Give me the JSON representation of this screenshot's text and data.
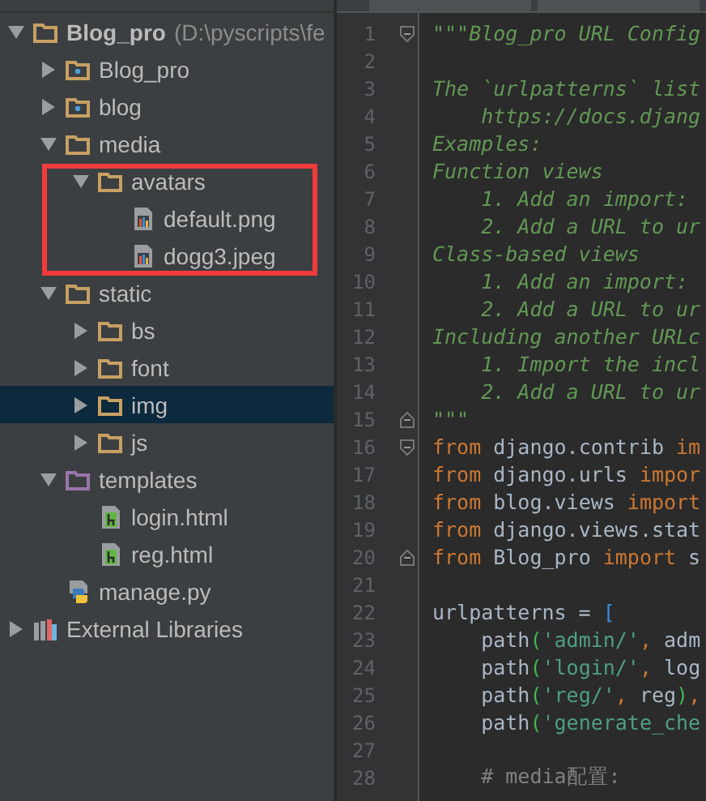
{
  "project_tree": {
    "nodes": [
      {
        "name": "Blog_pro",
        "path": "(D:\\pyscripts\\fe",
        "kind": "folder",
        "expanded": true,
        "selected": false,
        "highlighted": false,
        "children": [
          {
            "name": "Blog_pro",
            "kind": "package",
            "expanded": false,
            "selected": false,
            "highlighted": false
          },
          {
            "name": "blog",
            "kind": "package",
            "expanded": false,
            "selected": false,
            "highlighted": false
          },
          {
            "name": "media",
            "kind": "folder",
            "expanded": true,
            "selected": false,
            "highlighted": false,
            "children": [
              {
                "name": "avatars",
                "kind": "folder",
                "expanded": true,
                "selected": false,
                "highlighted": true,
                "children": [
                  {
                    "name": "default.png",
                    "kind": "image",
                    "selected": false,
                    "highlighted": false
                  },
                  {
                    "name": "dogg3.jpeg",
                    "kind": "image",
                    "selected": false,
                    "highlighted": false
                  }
                ]
              }
            ]
          },
          {
            "name": "static",
            "kind": "folder",
            "expanded": true,
            "selected": false,
            "highlighted": false,
            "children": [
              {
                "name": "bs",
                "kind": "folder",
                "expanded": false,
                "selected": false,
                "highlighted": false
              },
              {
                "name": "font",
                "kind": "folder",
                "expanded": false,
                "selected": false,
                "highlighted": false
              },
              {
                "name": "img",
                "kind": "folder",
                "expanded": false,
                "selected": true,
                "highlighted": false
              },
              {
                "name": "js",
                "kind": "folder",
                "expanded": false,
                "selected": false,
                "highlighted": false
              }
            ]
          },
          {
            "name": "templates",
            "kind": "templates",
            "expanded": true,
            "selected": false,
            "highlighted": false,
            "children": [
              {
                "name": "login.html",
                "kind": "html",
                "selected": false,
                "highlighted": false
              },
              {
                "name": "reg.html",
                "kind": "html",
                "selected": false,
                "highlighted": false
              }
            ]
          },
          {
            "name": "manage.py",
            "kind": "python",
            "selected": false,
            "highlighted": false
          }
        ]
      },
      {
        "name": "External Libraries",
        "kind": "library",
        "expanded": false,
        "selected": false,
        "highlighted": false
      }
    ]
  },
  "editor": {
    "lines": [
      {
        "number": "1",
        "kind": "fold_start",
        "tokens": [
          {
            "kind": "doc",
            "text": "\"\"\"Blog_pro URL Config"
          }
        ]
      },
      {
        "number": "2"
      },
      {
        "number": "3",
        "tokens": [
          {
            "kind": "doc",
            "text": "The `urlpatterns` list"
          }
        ]
      },
      {
        "number": "4",
        "tokens": [
          {
            "kind": "doc",
            "text": "    https://docs.djang"
          }
        ]
      },
      {
        "number": "5",
        "tokens": [
          {
            "kind": "doc",
            "text": "Examples:"
          }
        ]
      },
      {
        "number": "6",
        "tokens": [
          {
            "kind": "doc",
            "text": "Function views"
          }
        ]
      },
      {
        "number": "7",
        "tokens": [
          {
            "kind": "doc",
            "text": "    1. Add an import:"
          }
        ]
      },
      {
        "number": "8",
        "tokens": [
          {
            "kind": "doc",
            "text": "    2. Add a URL to ur"
          }
        ]
      },
      {
        "number": "9",
        "tokens": [
          {
            "kind": "doc",
            "text": "Class-based views"
          }
        ]
      },
      {
        "number": "10",
        "tokens": [
          {
            "kind": "doc",
            "text": "    1. Add an import:"
          }
        ]
      },
      {
        "number": "11",
        "tokens": [
          {
            "kind": "doc",
            "text": "    2. Add a URL to ur"
          }
        ]
      },
      {
        "number": "12",
        "tokens": [
          {
            "kind": "doc",
            "text": "Including another URLc"
          }
        ]
      },
      {
        "number": "13",
        "tokens": [
          {
            "kind": "doc",
            "text": "    1. Import the incl"
          }
        ]
      },
      {
        "number": "14",
        "tokens": [
          {
            "kind": "doc",
            "text": "    2. Add a URL to ur"
          }
        ]
      },
      {
        "number": "15",
        "kind": "fold_end",
        "tokens": [
          {
            "kind": "doc",
            "text": "\"\"\""
          }
        ]
      },
      {
        "number": "16",
        "kind": "fold_start",
        "tokens": [
          {
            "kind": "keyword",
            "text": "from"
          },
          {
            "kind": "plain",
            "text": " django.contrib "
          },
          {
            "kind": "keyword",
            "text": "im"
          }
        ]
      },
      {
        "number": "17",
        "tokens": [
          {
            "kind": "keyword",
            "text": "from"
          },
          {
            "kind": "plain",
            "text": " django.urls "
          },
          {
            "kind": "keyword",
            "text": "impor"
          }
        ]
      },
      {
        "number": "18",
        "tokens": [
          {
            "kind": "keyword",
            "text": "from"
          },
          {
            "kind": "plain",
            "text": " blog.views "
          },
          {
            "kind": "keyword",
            "text": "import"
          }
        ]
      },
      {
        "number": "19",
        "tokens": [
          {
            "kind": "keyword",
            "text": "from"
          },
          {
            "kind": "plain",
            "text": " django.views.stat"
          }
        ]
      },
      {
        "number": "20",
        "kind": "fold_end",
        "tokens": [
          {
            "kind": "keyword",
            "text": "from"
          },
          {
            "kind": "plain",
            "text": " Blog_pro "
          },
          {
            "kind": "keyword",
            "text": "import"
          },
          {
            "kind": "plain",
            "text": " s"
          }
        ]
      },
      {
        "number": "21"
      },
      {
        "number": "22",
        "tokens": [
          {
            "kind": "plain",
            "text": "urlpatterns = "
          },
          {
            "kind": "bracket",
            "text": "["
          }
        ]
      },
      {
        "number": "23",
        "tokens": [
          {
            "kind": "plain",
            "text": "    path"
          },
          {
            "kind": "paren",
            "text": "("
          },
          {
            "kind": "string",
            "text": "'admin/'"
          },
          {
            "kind": "punct",
            "text": ","
          },
          {
            "kind": "plain",
            "text": " adm"
          }
        ]
      },
      {
        "number": "24",
        "tokens": [
          {
            "kind": "plain",
            "text": "    path"
          },
          {
            "kind": "paren",
            "text": "("
          },
          {
            "kind": "string",
            "text": "'login/'"
          },
          {
            "kind": "punct",
            "text": ","
          },
          {
            "kind": "plain",
            "text": " log"
          }
        ]
      },
      {
        "number": "25",
        "tokens": [
          {
            "kind": "plain",
            "text": "    path"
          },
          {
            "kind": "paren",
            "text": "("
          },
          {
            "kind": "string",
            "text": "'reg/'"
          },
          {
            "kind": "punct",
            "text": ","
          },
          {
            "kind": "plain",
            "text": " reg"
          },
          {
            "kind": "paren",
            "text": ")"
          },
          {
            "kind": "punct",
            "text": ","
          }
        ]
      },
      {
        "number": "26",
        "tokens": [
          {
            "kind": "plain",
            "text": "    path"
          },
          {
            "kind": "paren",
            "text": "("
          },
          {
            "kind": "string",
            "text": "'generate_che"
          }
        ]
      },
      {
        "number": "27"
      },
      {
        "number": "28",
        "tokens": [
          {
            "kind": "comment",
            "text": "    # media配置:"
          }
        ]
      }
    ]
  }
}
